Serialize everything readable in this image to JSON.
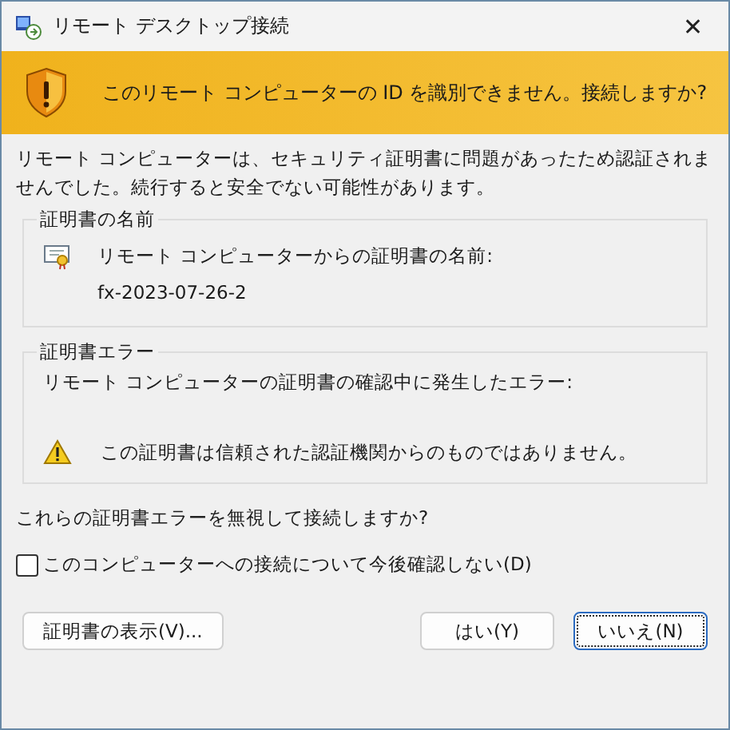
{
  "window": {
    "title": "リモート デスクトップ接続",
    "close": "✕"
  },
  "banner": {
    "text": "このリモート コンピューターの ID を識別できません。接続しますか?"
  },
  "description": "リモート コンピューターは、セキュリティ証明書に問題があったため認証されませんでした。続行すると安全でない可能性があります。",
  "groups": [
    {
      "kind": "certificate",
      "title": "証明書の名前",
      "label": "リモート コンピューターからの証明書の名前:",
      "value": "fx-2023-07-26-2"
    },
    {
      "kind": "errors",
      "title": "証明書エラー",
      "label": "リモート コンピューターの証明書の確認中に発生したエラー:",
      "value": "この証明書は信頼された認証機関からのものではありません。"
    }
  ],
  "question": "これらの証明書エラーを無視して接続しますか?",
  "checkbox": {
    "label": "このコンピューターへの接続について今後確認しない(D)",
    "checked": false
  },
  "buttons": [
    {
      "label": "証明書の表示(V)...",
      "focused": false
    },
    {
      "label": "はい(Y)",
      "focused": false
    },
    {
      "label": "いいえ(N)",
      "focused": true
    }
  ]
}
